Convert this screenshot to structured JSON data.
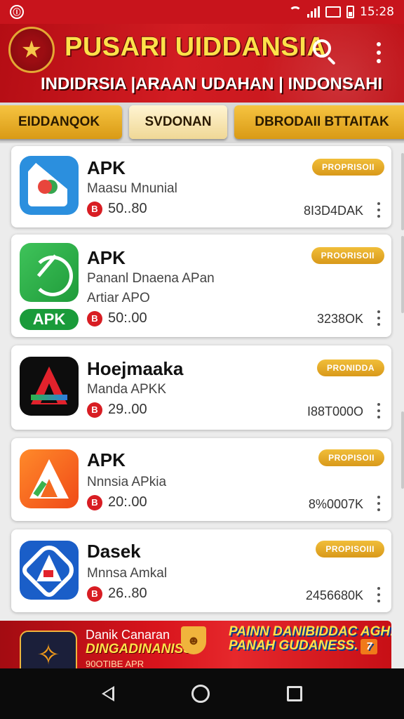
{
  "status_bar": {
    "time": "15:28",
    "left_icon": "notification-icon",
    "icons": [
      "wifi-icon",
      "signal-icon",
      "sim-card-icon",
      "battery-icon"
    ]
  },
  "header": {
    "title": "PUSARI UIDDANSIA",
    "subtitle": "INDIDRSIA |ARAAN UDAHAN | INDONSAHI",
    "emblem_icon": "star-emblem-icon",
    "search_icon": "search-icon",
    "menu_icon": "more-vert-icon",
    "emblem_symbol": "★"
  },
  "tabs": [
    {
      "label": "EIDDANQOK",
      "active": false
    },
    {
      "label": "SVDONAN",
      "active": true
    },
    {
      "label": "DBRODAII BTTAITAK",
      "active": false
    }
  ],
  "apps": [
    {
      "name": "APK",
      "desc1": "Maasu Mnunial",
      "desc2": "",
      "price": "50..80",
      "size": "8I3D4DAK",
      "badge": "PROPRISOII",
      "apk_label": ""
    },
    {
      "name": "APK",
      "desc1": "Pananl Dnaena APan",
      "desc2": "Artiar APO",
      "price": "50:.00",
      "size": "3238OK",
      "badge": "PROORISOII",
      "apk_label": "APK"
    },
    {
      "name": "Hoejmaaka",
      "desc1": "Manda APKK",
      "desc2": "",
      "price": "29..00",
      "size": "I88T000O",
      "badge": "PRONIDDA",
      "apk_label": ""
    },
    {
      "name": "APK",
      "desc1": "Nnnsia APkia",
      "desc2": "",
      "price": "20:.00",
      "size": "8%0007K",
      "badge": "PROPISOII",
      "apk_label": ""
    },
    {
      "name": "Dasek",
      "desc1": "Mnnsa Amkal",
      "desc2": "",
      "price": "26..80",
      "size": "2456680K",
      "badge": "PROPISOIII",
      "apk_label": ""
    }
  ],
  "price_icon_glyph": "B",
  "banner": {
    "line1": "Danik Canaran",
    "line2": "DINGADINANISS",
    "line3": "90OTIBE APR",
    "slogan_line1": "PAINN DANIBIDDAC AGH!",
    "slogan_line2": "PANAH GUDANESS.",
    "app_glyph": "✧",
    "shield_glyph": "☻",
    "slogan_mark": "7"
  },
  "nav": {
    "back_icon": "back-icon",
    "home_icon": "home-icon",
    "recents_icon": "recents-icon"
  },
  "colors": {
    "brand_red": "#c8141c",
    "gold": "#e0a526",
    "apk_green": "#1a9b3a"
  }
}
